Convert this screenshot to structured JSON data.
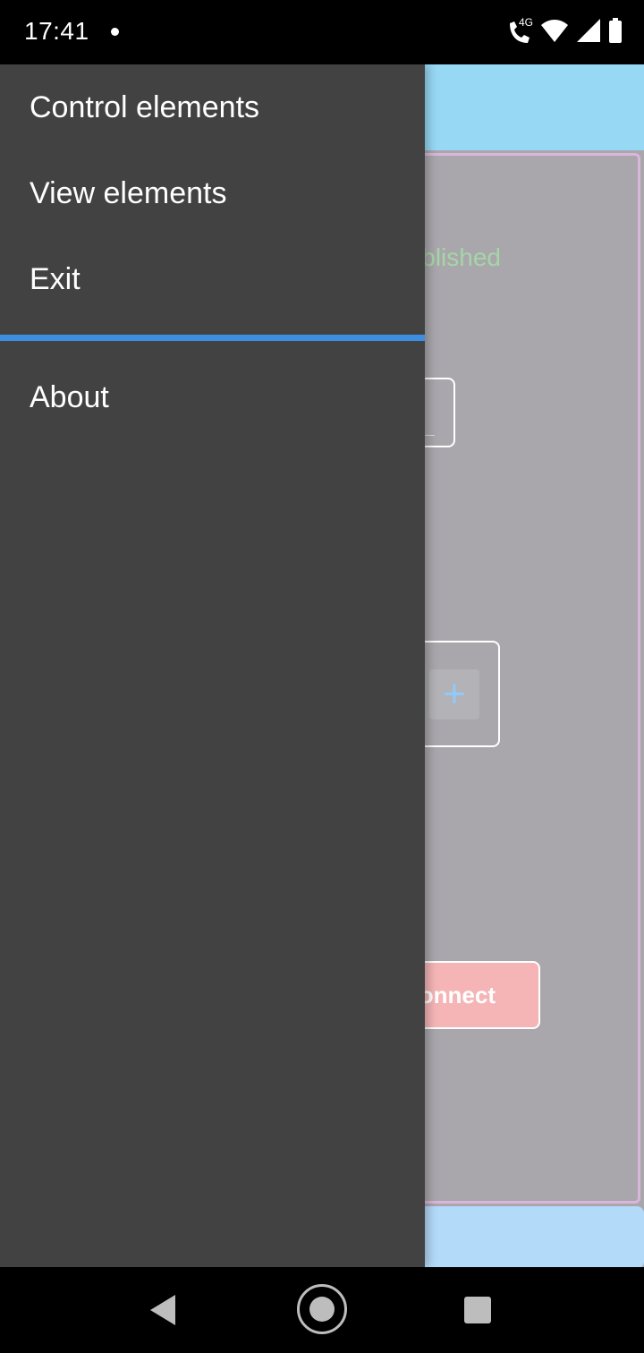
{
  "status_bar": {
    "time": "17:41",
    "network_label": "4G",
    "icons": [
      "notification-dot-icon",
      "wifi-calling-icon",
      "wifi-icon",
      "cell-signal-icon",
      "battery-icon"
    ]
  },
  "drawer": {
    "items": [
      {
        "label": "Control elements"
      },
      {
        "label": "View elements"
      },
      {
        "label": "Exit"
      }
    ],
    "secondary_items": [
      {
        "label": "About"
      }
    ],
    "divider_color": "#3d8ee2",
    "background": "#424242"
  },
  "background_app": {
    "status_text_fragment": "blished",
    "plus_label": "+",
    "connect_label_fragment": "onnect"
  },
  "nav_bar": {
    "buttons": [
      "back-icon",
      "home-icon",
      "recent-apps-icon"
    ]
  }
}
